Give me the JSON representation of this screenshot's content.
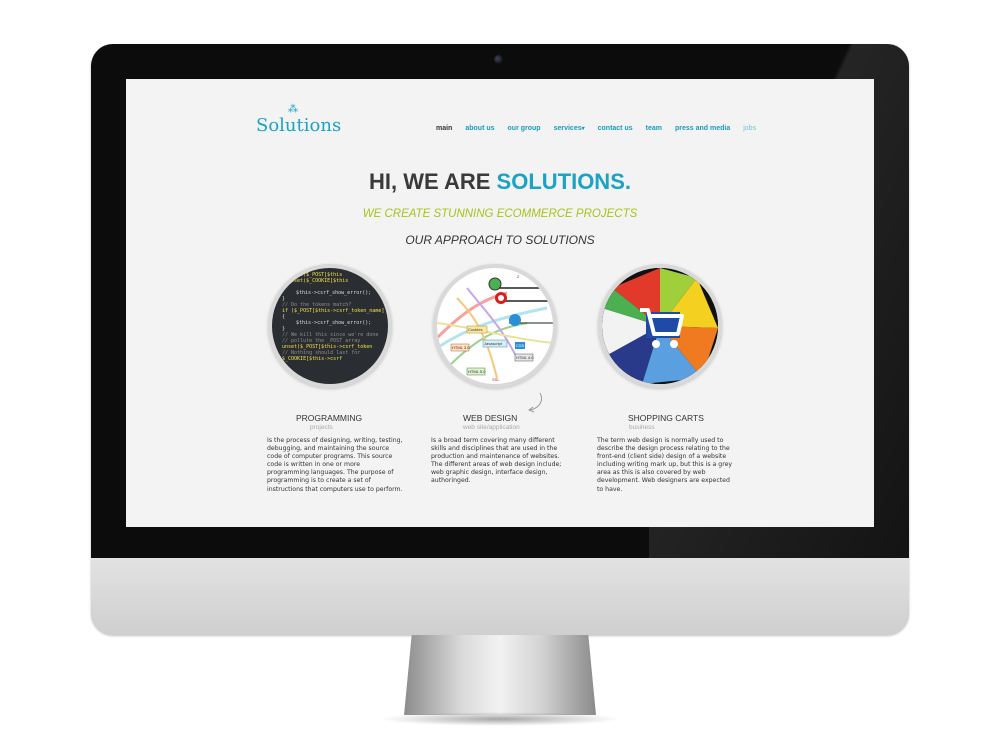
{
  "site": {
    "logo": "Solutions",
    "nav": [
      {
        "label": "main",
        "state": "active"
      },
      {
        "label": "about us"
      },
      {
        "label": "our group"
      },
      {
        "label": "services",
        "dropdown": true
      },
      {
        "label": "contact us"
      },
      {
        "label": "team"
      },
      {
        "label": "press and media"
      },
      {
        "label": "jobs",
        "state": "muted"
      }
    ],
    "hero": {
      "lead": "HI, WE ARE ",
      "accent": "SOLUTIONS."
    },
    "tagline": "WE CREATE STUNNING ECOMMERCE PROJECTS",
    "approach_title": "OUR APPROACH TO SOLUTIONS",
    "columns": [
      {
        "title": "PROGRAMMING",
        "subtitle": "projects",
        "text": "Is the process of designing, writing, testing, debugging, and maintaining the source code of computer programs. This source code is written in one or more programming languages. The purpose of programming is to create a set of instructions that computers use to perform."
      },
      {
        "title": "WEB DESIGN",
        "subtitle": "web site/application",
        "text": "Is a broad term covering many different skills and disciplines that are used in the production and maintenance of websites. The different areas of web design include; web graphic design, interface design, authoringed."
      },
      {
        "title": "SHOPPING CARTS",
        "subtitle": "business",
        "text": "The term web design is normally used to describe the design process relating to the front-end (client side) design of a website including writing mark up, but this is a grey area as this is also covered by web development. Web designers are expected to have."
      }
    ],
    "code_lines": [
      "! isset($_POST[$this",
      "! isset($_COOKIE[$this",
      "{",
      "$this->csrf_show_error();",
      "}",
      "// Do the tokens match?",
      "if ($_POST[$this->csrf_token_name]",
      "{",
      "$this->csrf_show_error();",
      "}",
      "// We kill this since we're done",
      "// pollute the _POST array",
      "unset($_POST[$this->csrf_token",
      "// Nothing should last for",
      "$_COOKIE[$this->csrf"
    ],
    "web_labels": [
      "Cookies",
      "Javascript",
      "HTML 3.0",
      "HTML 5.0",
      "HTML 4.0",
      "SSL",
      "CSS"
    ],
    "colors": {
      "brand": "#1aa3c4",
      "tagline": "#a7c31b",
      "screen_bg": "#f3f3f3",
      "bezel": "#0c0c0c"
    },
    "icons": [
      "camera-icon",
      "chrome-icon",
      "opera-icon",
      "ie-icon",
      "cart-icon",
      "arrow-icon"
    ]
  }
}
